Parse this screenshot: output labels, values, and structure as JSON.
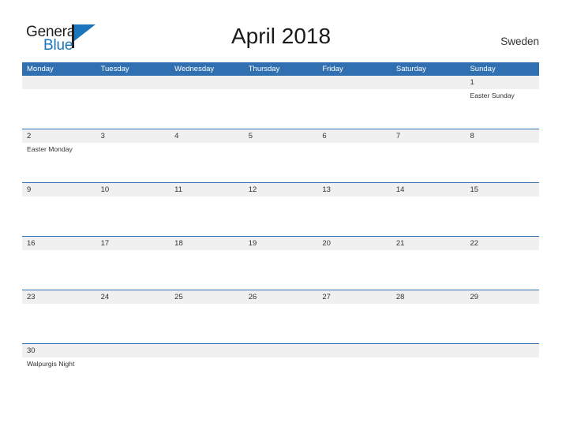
{
  "brand": {
    "name_part1": "General",
    "name_part2": "Blue",
    "flag_icon": "triangle-flag-icon",
    "color_dark": "#231f20",
    "color_blue": "#1b75bb"
  },
  "header": {
    "title": "April 2018",
    "country": "Sweden"
  },
  "theme": {
    "header_blue": "#3170b0",
    "row_line_blue": "#3170b0",
    "date_band_gray": "#f0f0f0",
    "text_dark": "#333333"
  },
  "calendar": {
    "weekdays": [
      "Monday",
      "Tuesday",
      "Wednesday",
      "Thursday",
      "Friday",
      "Saturday",
      "Sunday"
    ],
    "weeks": [
      {
        "days": [
          {
            "num": "",
            "events": []
          },
          {
            "num": "",
            "events": []
          },
          {
            "num": "",
            "events": []
          },
          {
            "num": "",
            "events": []
          },
          {
            "num": "",
            "events": []
          },
          {
            "num": "",
            "events": []
          },
          {
            "num": "1",
            "events": [
              "Easter Sunday"
            ]
          }
        ]
      },
      {
        "days": [
          {
            "num": "2",
            "events": [
              "Easter Monday"
            ]
          },
          {
            "num": "3",
            "events": []
          },
          {
            "num": "4",
            "events": []
          },
          {
            "num": "5",
            "events": []
          },
          {
            "num": "6",
            "events": []
          },
          {
            "num": "7",
            "events": []
          },
          {
            "num": "8",
            "events": []
          }
        ]
      },
      {
        "days": [
          {
            "num": "9",
            "events": []
          },
          {
            "num": "10",
            "events": []
          },
          {
            "num": "11",
            "events": []
          },
          {
            "num": "12",
            "events": []
          },
          {
            "num": "13",
            "events": []
          },
          {
            "num": "14",
            "events": []
          },
          {
            "num": "15",
            "events": []
          }
        ]
      },
      {
        "days": [
          {
            "num": "16",
            "events": []
          },
          {
            "num": "17",
            "events": []
          },
          {
            "num": "18",
            "events": []
          },
          {
            "num": "19",
            "events": []
          },
          {
            "num": "20",
            "events": []
          },
          {
            "num": "21",
            "events": []
          },
          {
            "num": "22",
            "events": []
          }
        ]
      },
      {
        "days": [
          {
            "num": "23",
            "events": []
          },
          {
            "num": "24",
            "events": []
          },
          {
            "num": "25",
            "events": []
          },
          {
            "num": "26",
            "events": []
          },
          {
            "num": "27",
            "events": []
          },
          {
            "num": "28",
            "events": []
          },
          {
            "num": "29",
            "events": []
          }
        ]
      },
      {
        "days": [
          {
            "num": "30",
            "events": [
              "Walpurgis Night"
            ]
          },
          {
            "num": "",
            "events": []
          },
          {
            "num": "",
            "events": []
          },
          {
            "num": "",
            "events": []
          },
          {
            "num": "",
            "events": []
          },
          {
            "num": "",
            "events": []
          },
          {
            "num": "",
            "events": []
          }
        ]
      }
    ]
  }
}
